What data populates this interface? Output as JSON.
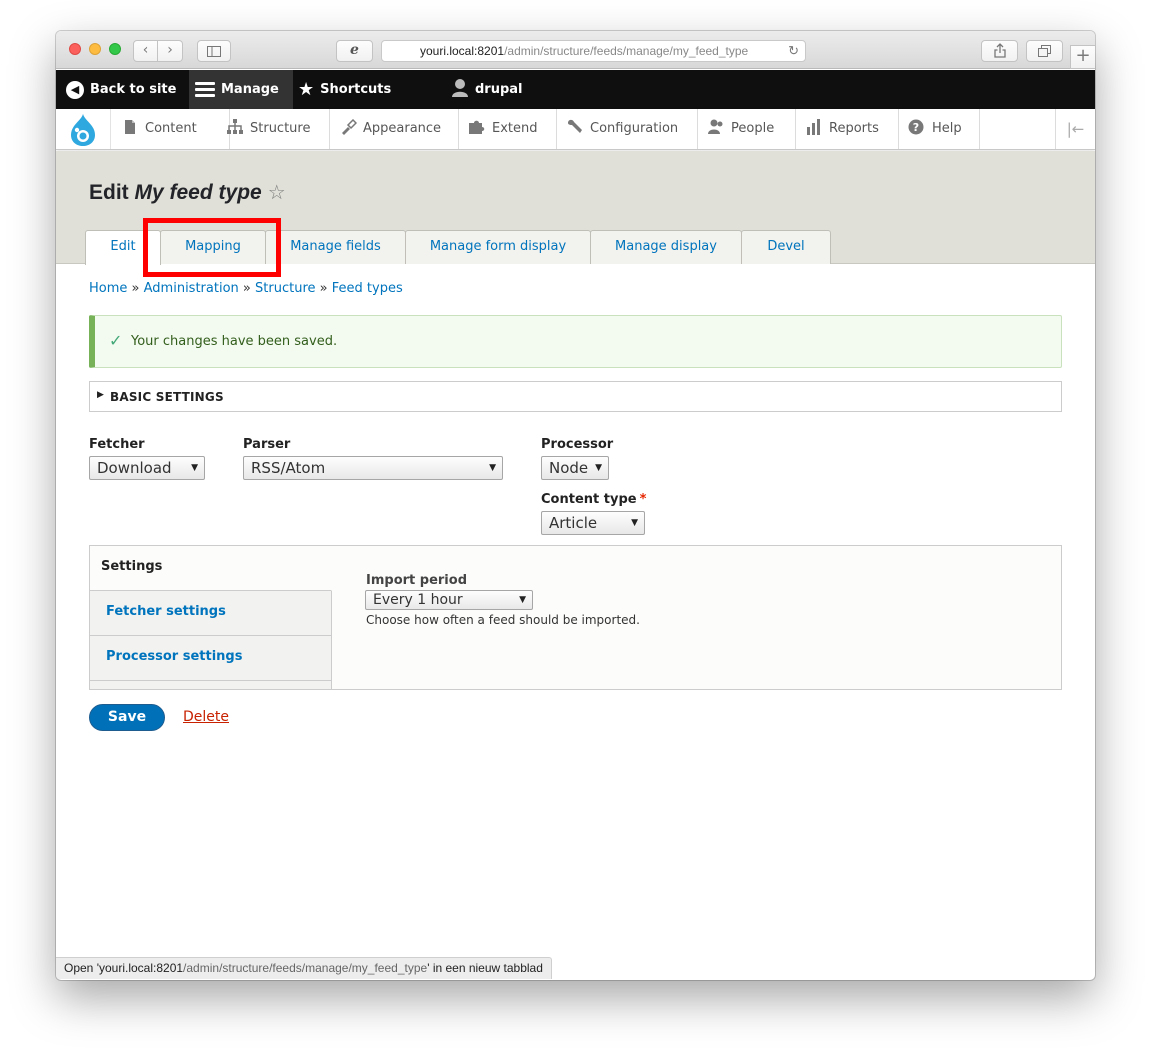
{
  "browser": {
    "url_host": "youri.local:8201",
    "url_path": "/admin/structure/feeds/manage/my_feed_type",
    "status_prefix": "Open '",
    "status_host": "youri.local:8201",
    "status_path": "/admin/structure/feeds/manage/my_feed_type",
    "status_suffix": "' in een nieuw tabblad"
  },
  "toolbar": {
    "back_label": "Back to site",
    "manage_label": "Manage",
    "shortcuts_label": "Shortcuts",
    "user_label": "drupal"
  },
  "admin_menu": {
    "items": [
      {
        "label": "Content",
        "icon": "document-icon"
      },
      {
        "label": "Structure",
        "icon": "sitemap-icon"
      },
      {
        "label": "Appearance",
        "icon": "brush-icon"
      },
      {
        "label": "Extend",
        "icon": "puzzle-icon"
      },
      {
        "label": "Configuration",
        "icon": "wrench-icon"
      },
      {
        "label": "People",
        "icon": "people-icon"
      },
      {
        "label": "Reports",
        "icon": "bar-chart-icon"
      },
      {
        "label": "Help",
        "icon": "help-icon"
      }
    ]
  },
  "page": {
    "title_prefix": "Edit ",
    "title_name": "My feed type",
    "tabs": [
      "Edit",
      "Mapping",
      "Manage fields",
      "Manage form display",
      "Manage display",
      "Devel"
    ],
    "active_tab": "Edit"
  },
  "breadcrumb": [
    "Home",
    "Administration",
    "Structure",
    "Feed types"
  ],
  "breadcrumb_sep": "»",
  "status_message": "Your changes have been saved.",
  "details_label": "BASIC SETTINGS",
  "form": {
    "fetcher_label": "Fetcher",
    "fetcher_value": "Download",
    "parser_label": "Parser",
    "parser_value": "RSS/Atom",
    "processor_label": "Processor",
    "processor_value": "Node",
    "content_type_label": "Content type",
    "content_type_required": "*",
    "content_type_value": "Article"
  },
  "vertical_tabs": {
    "items": [
      "Settings",
      "Fetcher settings",
      "Processor settings"
    ],
    "active": "Settings",
    "import_period_label": "Import period",
    "import_period_value": "Every 1 hour",
    "import_period_desc": "Choose how often a feed should be imported."
  },
  "actions": {
    "save_label": "Save",
    "delete_label": "Delete"
  },
  "colors": {
    "link": "#0074bd",
    "toolbar_bg": "#0f0f0f",
    "header_bg": "#e0e0d8",
    "status_accent": "#77b259",
    "save_bg": "#0071b8",
    "delete": "#c72100",
    "highlight": "#ff0000"
  }
}
